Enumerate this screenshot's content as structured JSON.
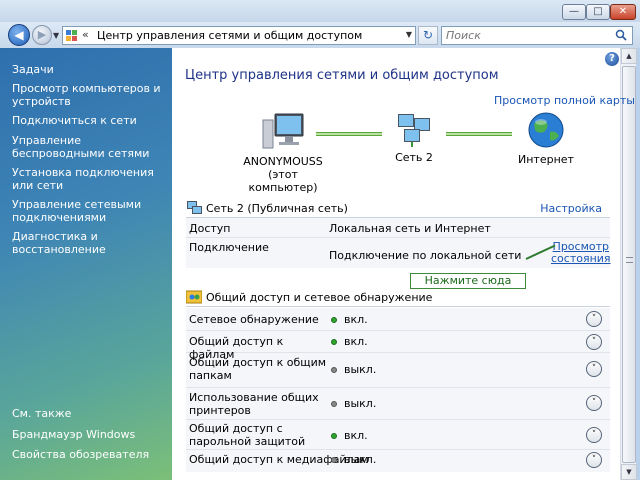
{
  "address": {
    "path": "Центр управления сетями и общим доступом"
  },
  "search": {
    "placeholder": "Поиск"
  },
  "sidebar": {
    "tasks_heading": "Задачи",
    "items": [
      "Просмотр компьютеров и устройств",
      "Подключиться к сети",
      "Управление беспроводными сетями",
      "Установка подключения или сети",
      "Управление сетевыми подключениями",
      "Диагностика и восстановление"
    ],
    "see_also_heading": "См. также",
    "see_also": [
      "Брандмауэр Windows",
      "Свойства обозревателя"
    ]
  },
  "main": {
    "title": "Центр управления сетями и общим доступом",
    "full_map_link": "Просмотр полной карты",
    "map": {
      "computer_name": "ANONYMOUSS",
      "computer_sub": "(этот компьютер)",
      "network_name": "Сеть  2",
      "internet": "Интернет"
    },
    "network": {
      "title": "Сеть  2 (Публичная сеть)",
      "settings_link": "Настройка",
      "access_label": "Доступ",
      "access_value": "Локальная сеть и Интернет",
      "connection_label": "Подключение",
      "connection_value": "Подключение по локальной сети",
      "status_link_line1": "Просмотр",
      "status_link_line2": "состояния"
    },
    "callout": "Нажмите сюда",
    "sharing": {
      "title": "Общий доступ и сетевое обнаружение",
      "rows": [
        {
          "label": "Сетевое обнаружение",
          "state": "вкл.",
          "on": true
        },
        {
          "label": "Общий доступ к файлам",
          "state": "вкл.",
          "on": true
        },
        {
          "label": "Общий доступ к общим папкам",
          "state": "выкл.",
          "on": false
        },
        {
          "label": "Использование общих принтеров",
          "state": "выкл.",
          "on": false
        },
        {
          "label": "Общий доступ с парольной защитой",
          "state": "вкл.",
          "on": true
        },
        {
          "label": "Общий доступ к медиафайлам",
          "state": "выкл.",
          "on": false
        }
      ]
    }
  },
  "colors": {
    "title_blue": "#1e3287",
    "link_blue": "#1a56b6",
    "status_on": "#2fa52f",
    "status_off": "#888888"
  }
}
